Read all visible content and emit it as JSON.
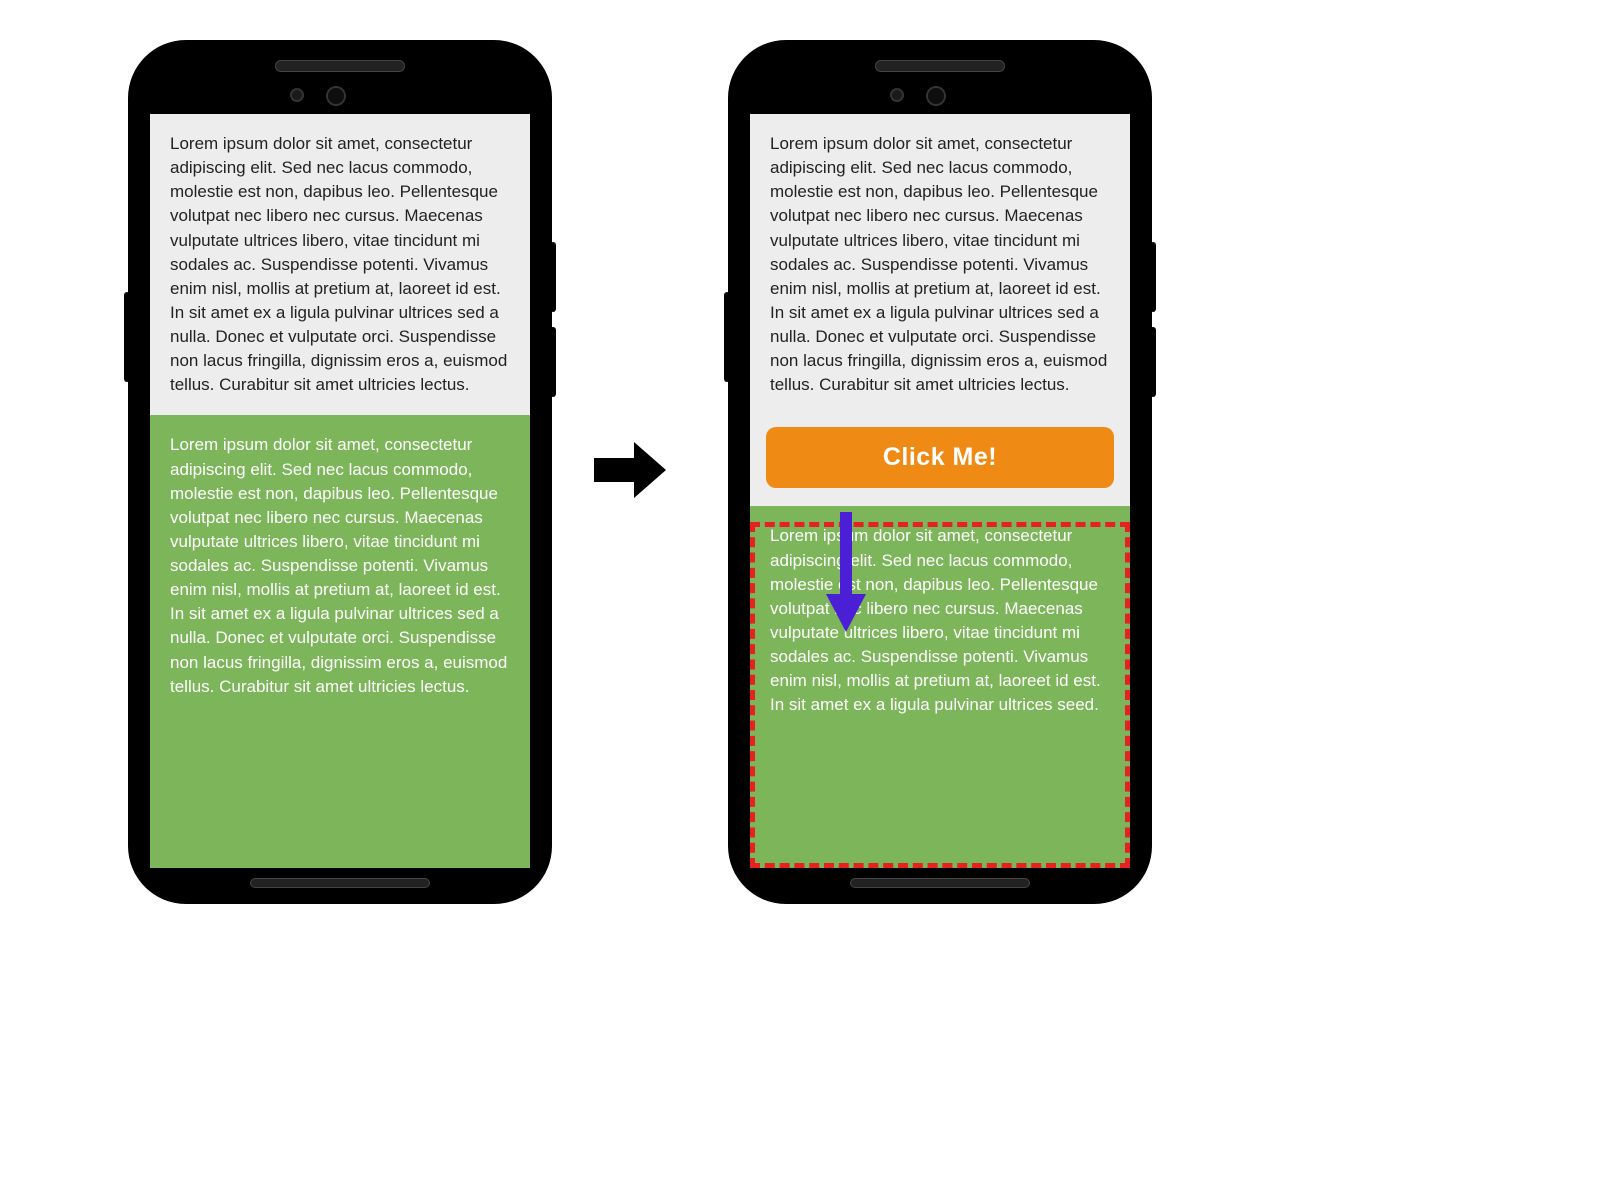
{
  "lorem_full": "Lorem ipsum dolor sit amet, consectetur adipiscing elit. Sed nec lacus commodo, molestie est non, dapibus leo. Pellentesque volutpat nec libero nec cursus. Maecenas vulputate ultrices libero, vitae tincidunt mi sodales ac. Suspendisse potenti. Vivamus enim nisl, mollis at pretium at, laoreet id est. In sit amet ex a ligula pulvinar ultrices sed a nulla. Donec et vulputate orci. Suspendisse non lacus fringilla, dignissim eros a, euismod tellus. Curabitur sit amet ultricies lectus.",
  "lorem_short": "Lorem ipsum dolor sit amet, consectetur adipiscing elit. Sed nec lacus commodo, molestie est non, dapibus leo. Pellentesque volutpat nec libero nec cursus. Maecenas vulputate ultrices libero, vitae tincidunt mi sodales ac. Suspendisse potenti. Vivamus enim nisl, mollis at pretium at, laoreet id est. In sit amet ex a ligula pulvinar ultrices seed.",
  "cta_label": "Click Me!",
  "colors": {
    "green_block": "#7cb55a",
    "cta_bg": "#ef8a14",
    "overlay_border": "#e52121",
    "down_arrow": "#4a1fd6"
  }
}
